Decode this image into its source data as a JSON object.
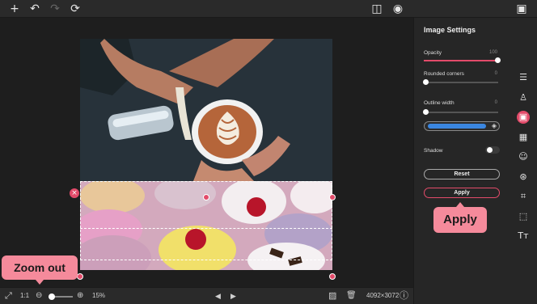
{
  "topbar": {
    "add_icon": "+",
    "undo_icon": "↶",
    "redo_icon": "↷",
    "reset_icon": "⟳",
    "compare_icon": "◫",
    "preview_icon": "◉",
    "save_icon": "▣"
  },
  "bottombar": {
    "fit_icon": "⤢",
    "ratio_label": "1:1",
    "zoom_out_icon": "⊖",
    "zoom_in_icon": "⊕",
    "zoom_value": "15%",
    "zoom_fraction": 0.1,
    "prev_icon": "◀",
    "next_icon": "▶",
    "image_icon": "▨",
    "delete_icon": "🗑",
    "dimensions": "4092×3072",
    "info_icon": "ⓘ"
  },
  "panel": {
    "title": "Image Settings",
    "opacity_label": "Opacity",
    "opacity_value": "100",
    "opacity_fraction": 1.0,
    "rounded_label": "Rounded corners",
    "rounded_value": "0",
    "outline_label": "Outline width",
    "outline_value": "0",
    "outline_color": "#3a86e0",
    "shadow_label": "Shadow",
    "shadow_on": false,
    "reset_label": "Reset",
    "apply_label": "Apply"
  },
  "rail": {
    "icons": [
      "sliders-icon",
      "stamp-icon",
      "image-icon",
      "checker-icon",
      "emoji-icon",
      "layers-icon",
      "crop-icon",
      "resize-icon",
      "text-icon"
    ],
    "glyphs": [
      "☰",
      "♙",
      "▣",
      "▦",
      "☺",
      "⊛",
      "⌗",
      "⬚",
      "Tт"
    ],
    "active_index": 2
  },
  "callouts": {
    "zoom_out": "Zoom out",
    "apply": "Apply"
  },
  "colors": {
    "accent": "#e34b6a",
    "callout": "#f58a9b"
  }
}
